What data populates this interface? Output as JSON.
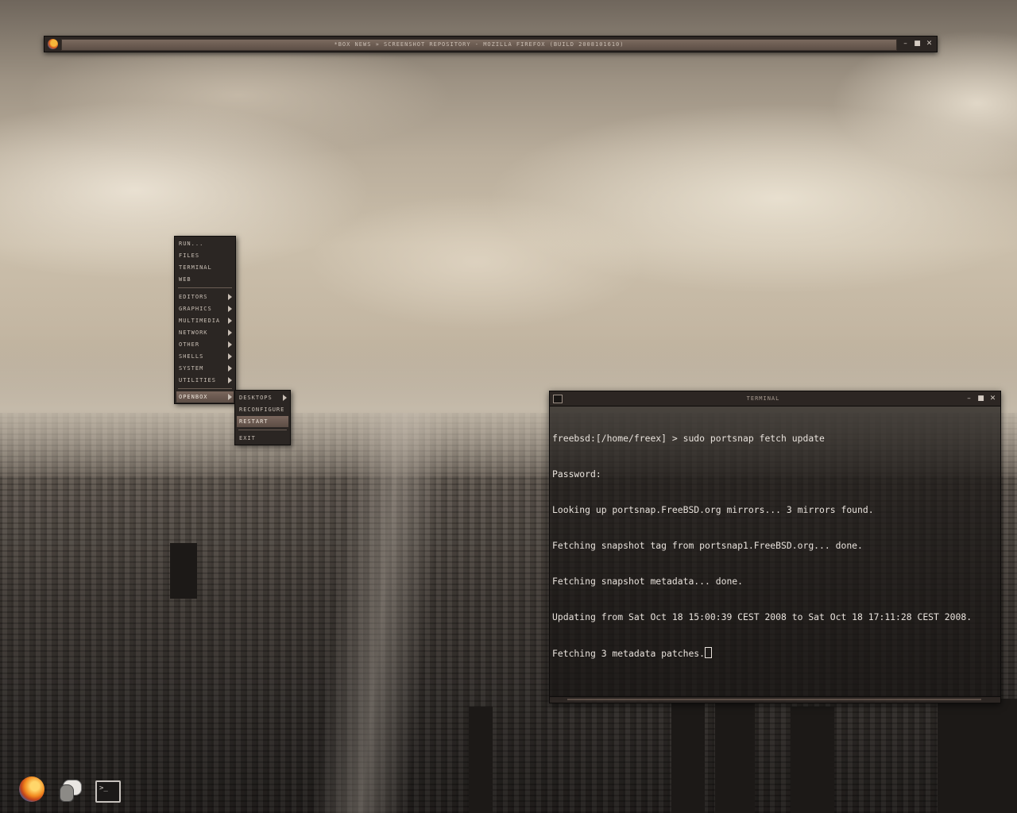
{
  "firefox": {
    "title": "*Box News » Screenshot Repository - Mozilla Firefox (Build 2008101610)",
    "buttons": {
      "minimize": "–",
      "maximize": "■",
      "close": "✕"
    }
  },
  "root_menu": {
    "items": [
      {
        "label": "Run..."
      },
      {
        "label": "Files"
      },
      {
        "label": "Terminal"
      },
      {
        "label": "Web"
      },
      {
        "label": "Editors"
      },
      {
        "label": "Graphics"
      },
      {
        "label": "Multimedia"
      },
      {
        "label": "Network"
      },
      {
        "label": "Other"
      },
      {
        "label": "Shells"
      },
      {
        "label": "System"
      },
      {
        "label": "Utilities"
      },
      {
        "label": "Openbox"
      }
    ]
  },
  "openbox_submenu": {
    "items": [
      {
        "label": "Desktops"
      },
      {
        "label": "Reconfigure"
      },
      {
        "label": "Restart"
      },
      {
        "label": "Exit"
      }
    ]
  },
  "terminal": {
    "title": "Terminal",
    "buttons": {
      "minimize": "–",
      "maximize": "■",
      "close": "✕"
    },
    "lines": [
      "freebsd:[/home/freex] > sudo portsnap fetch update",
      "Password:",
      "Looking up portsnap.FreeBSD.org mirrors... 3 mirrors found.",
      "Fetching snapshot tag from portsnap1.FreeBSD.org... done.",
      "Fetching snapshot metadata... done.",
      "Updating from Sat Oct 18 15:00:39 CEST 2008 to Sat Oct 18 17:11:28 CEST 2008.",
      "Fetching 3 metadata patches."
    ]
  },
  "dock": {
    "icons": [
      "firefox-icon",
      "pidgin-icon",
      "terminal-icon"
    ],
    "terminal_glyph": ">_"
  },
  "colors": {
    "menu_highlight": "#6b5a50",
    "titlebar": "#2c2623",
    "terminal_text": "#e8e2dc"
  }
}
